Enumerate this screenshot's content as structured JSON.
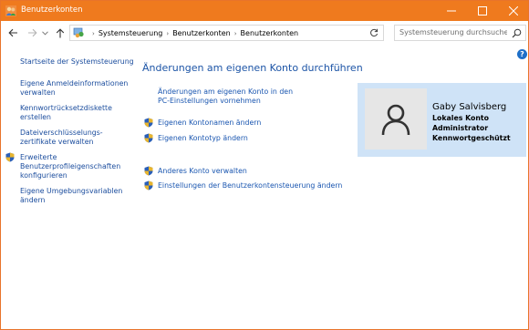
{
  "window": {
    "title": "Benutzerkonten",
    "accent": "#ef7a1e"
  },
  "address": {
    "crumbs": [
      "Systemsteuerung",
      "Benutzerkonten",
      "Benutzerkonten"
    ],
    "search_placeholder": "Systemsteuerung durchsuchen"
  },
  "sidebar": {
    "items": [
      {
        "label": "Startseite der Systemsteuerung",
        "shield": false
      },
      {
        "label": "Eigene Anmeldeinformationen verwalten",
        "shield": false
      },
      {
        "label": "Kennwortrücksetzdiskette erstellen",
        "shield": false
      },
      {
        "label": "Dateiverschlüsselungs-zertifikate verwalten",
        "shield": false
      },
      {
        "label": "Erweiterte Benutzerprofileigenschaften konfigurieren",
        "shield": true
      },
      {
        "label": "Eigene Umgebungsvariablen ändern",
        "shield": false
      }
    ]
  },
  "main": {
    "heading": "Änderungen am eigenen Konto durchführen",
    "links": [
      {
        "label": "Änderungen am eigenen Konto in den PC-Einstellungen vornehmen",
        "shield": false
      },
      {
        "label": "Eigenen Kontonamen ändern",
        "shield": true
      },
      {
        "label": "Eigenen Kontotyp ändern",
        "shield": true
      },
      {
        "label": "Anderes Konto verwalten",
        "shield": true
      },
      {
        "label": "Einstellungen der Benutzerkontensteuerung ändern",
        "shield": true
      }
    ]
  },
  "user": {
    "name": "Gaby Salvisberg",
    "lines": [
      "Lokales Konto",
      "Administrator",
      "Kennwortgeschützt"
    ]
  }
}
